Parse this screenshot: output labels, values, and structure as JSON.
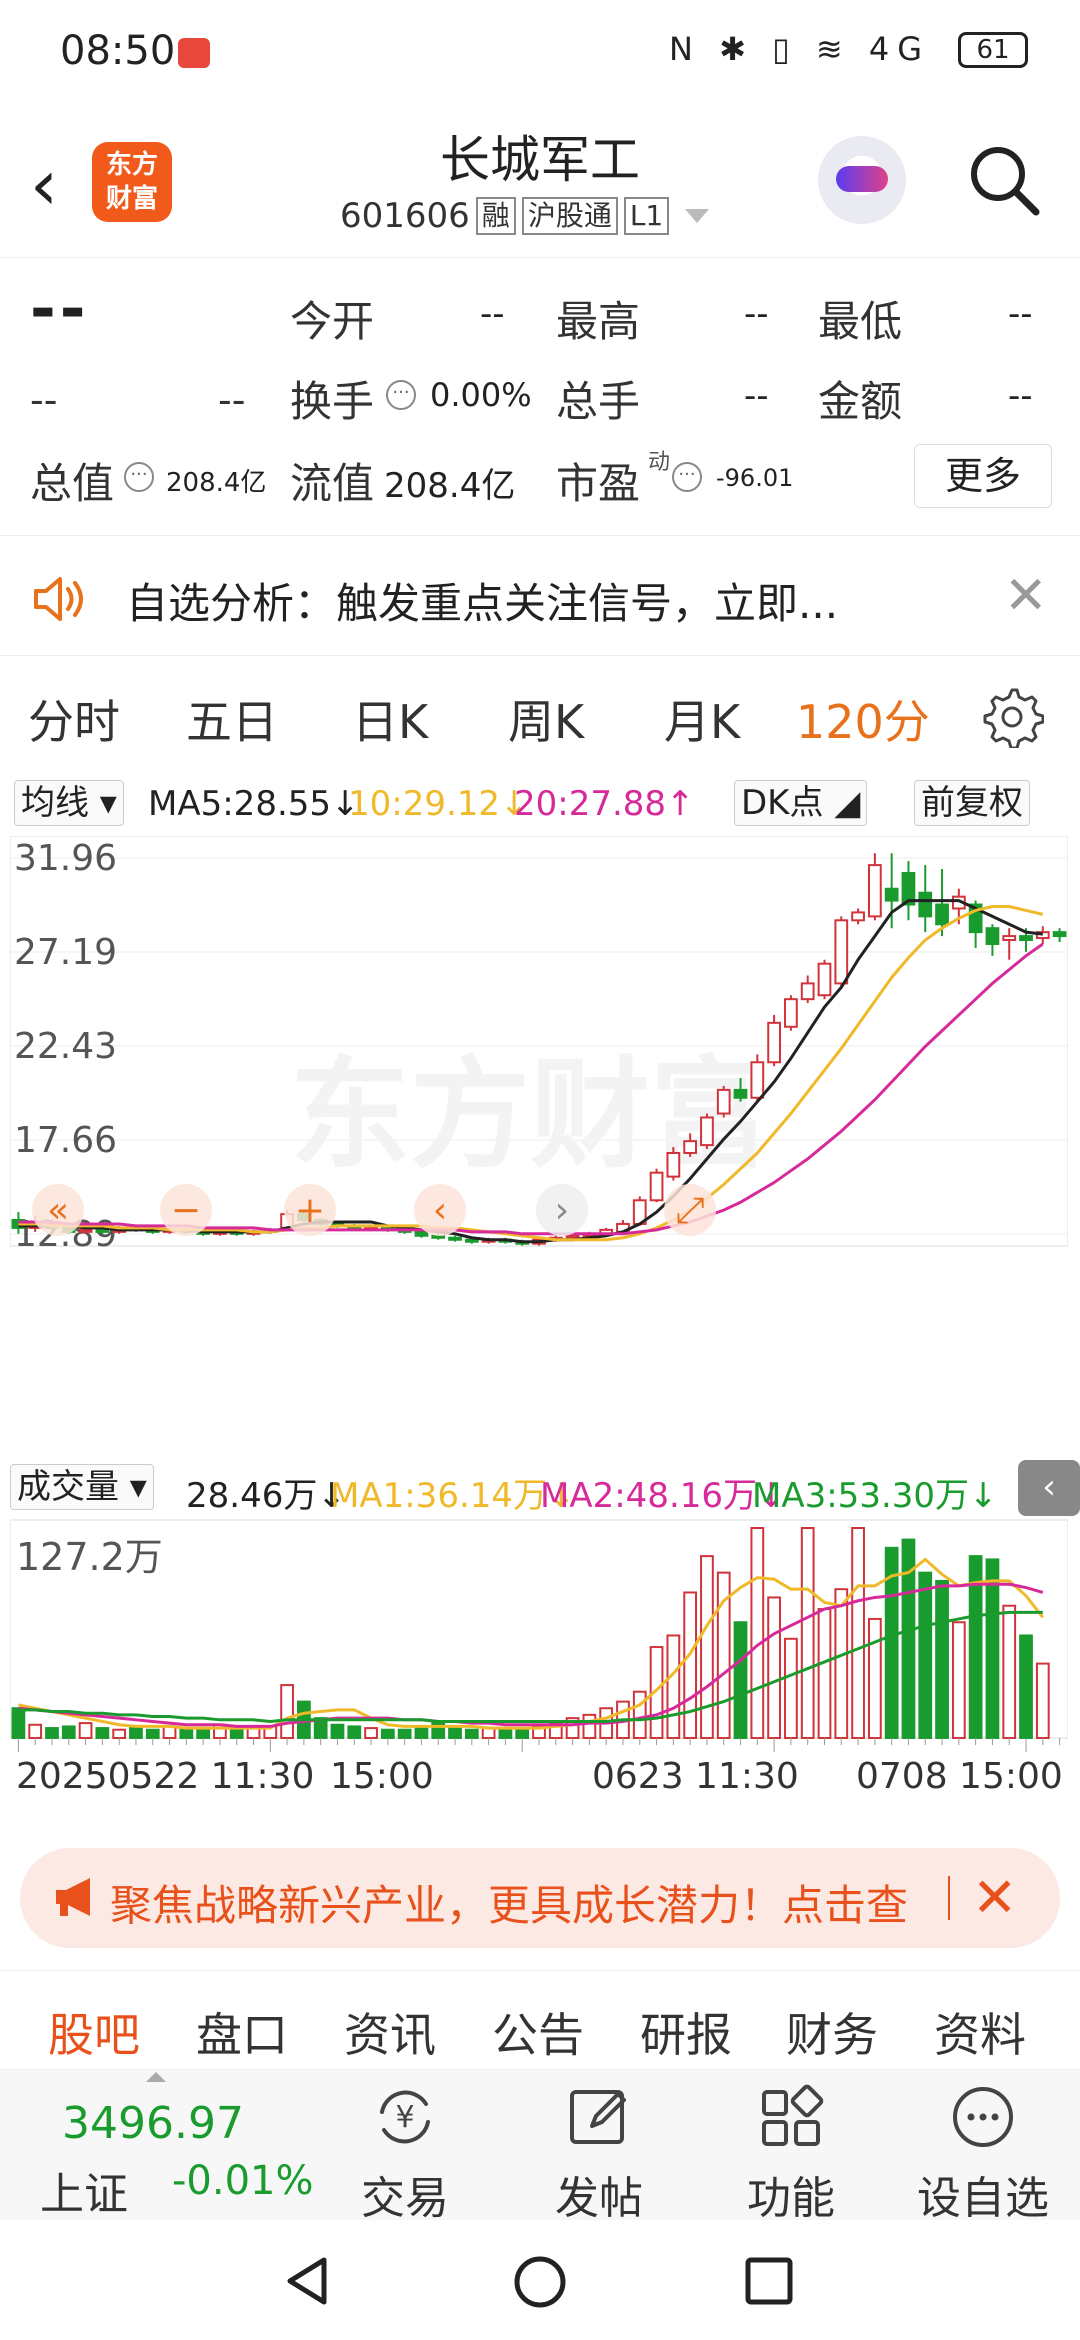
{
  "status_bar": {
    "time": "08:50",
    "icons": "N ✱ ▯ ≋ 4G",
    "battery": "61"
  },
  "header": {
    "title": "长城军工",
    "code": "601606",
    "tags": [
      "融",
      "沪股通",
      "L1"
    ],
    "logo_text": "东方财富"
  },
  "quote": {
    "price": "--",
    "change": "--",
    "change_pct": "--",
    "open_label": "今开",
    "open_value": "--",
    "high_label": "最高",
    "high_value": "--",
    "low_label": "最低",
    "low_value": "--",
    "turnover_label": "换手",
    "turnover_value": "0.00%",
    "volume_label": "总手",
    "volume_value": "--",
    "amount_label": "金额",
    "amount_value": "--",
    "mktcap_label": "总值",
    "mktcap_value": "208.4亿",
    "float_label": "流值",
    "float_value": "208.4亿",
    "pe_label": "市盈",
    "pe_sup": "动",
    "pe_value": "-96.01",
    "more_button": "更多"
  },
  "notice": {
    "text": "自选分析：触发重点关注信号，立即..."
  },
  "period_tabs": [
    "分时",
    "五日",
    "日K",
    "周K",
    "月K",
    "120分"
  ],
  "active_period": "120分",
  "ma_bar": {
    "select": "均线",
    "ma5": "MA5:28.55↓",
    "ma10": "10:29.12↓",
    "ma20": "20:27.88↑",
    "dk_button": "DK点",
    "adjust_button": "前复权"
  },
  "vol_bar": {
    "select": "成交量",
    "vol": "28.46万↓",
    "ma1": "MA1:36.14万↓",
    "ma2": "MA2:48.16万↓",
    "ma3": "MA3:53.30万↓"
  },
  "chart_data": {
    "type": "candlestick",
    "price_ticks": [
      "31.96",
      "27.19",
      "22.43",
      "17.66",
      "12.89"
    ],
    "ylim": [
      12.89,
      31.96
    ],
    "volume_max_label": "127.2万",
    "x_labels": [
      "20250522 11:30",
      "15:00",
      "0623 11:30",
      "0708 15:00"
    ],
    "watermark": "东方财富",
    "candles": [
      {
        "o": 13.6,
        "c": 13.2,
        "h": 14.0,
        "l": 12.9
      },
      {
        "o": 13.2,
        "c": 13.5,
        "h": 13.8,
        "l": 13.0
      },
      {
        "o": 13.4,
        "c": 13.2,
        "h": 13.6,
        "l": 13.0
      },
      {
        "o": 13.2,
        "c": 13.0,
        "h": 13.4,
        "l": 12.9
      },
      {
        "o": 13.0,
        "c": 13.1,
        "h": 13.3,
        "l": 12.9
      },
      {
        "o": 13.1,
        "c": 13.0,
        "h": 13.2,
        "l": 12.9
      },
      {
        "o": 13.0,
        "c": 13.2,
        "h": 13.3,
        "l": 12.9
      },
      {
        "o": 13.2,
        "c": 13.1,
        "h": 13.3,
        "l": 13.0
      },
      {
        "o": 13.1,
        "c": 13.0,
        "h": 13.2,
        "l": 12.9
      },
      {
        "o": 13.0,
        "c": 13.1,
        "h": 13.2,
        "l": 12.9
      },
      {
        "o": 13.1,
        "c": 13.0,
        "h": 13.2,
        "l": 12.9
      },
      {
        "o": 13.0,
        "c": 12.9,
        "h": 13.1,
        "l": 12.8
      },
      {
        "o": 12.9,
        "c": 13.0,
        "h": 13.1,
        "l": 12.8
      },
      {
        "o": 13.0,
        "c": 12.9,
        "h": 13.1,
        "l": 12.8
      },
      {
        "o": 12.9,
        "c": 13.0,
        "h": 13.1,
        "l": 12.8
      },
      {
        "o": 13.0,
        "c": 13.1,
        "h": 13.2,
        "l": 12.9
      },
      {
        "o": 13.2,
        "c": 13.9,
        "h": 14.1,
        "l": 13.1
      },
      {
        "o": 13.9,
        "c": 13.6,
        "h": 14.0,
        "l": 13.5
      },
      {
        "o": 13.6,
        "c": 13.4,
        "h": 13.7,
        "l": 13.3
      },
      {
        "o": 13.4,
        "c": 13.3,
        "h": 13.5,
        "l": 13.2
      },
      {
        "o": 13.3,
        "c": 13.2,
        "h": 13.4,
        "l": 13.1
      },
      {
        "o": 13.2,
        "c": 13.2,
        "h": 13.3,
        "l": 13.1
      },
      {
        "o": 13.2,
        "c": 13.1,
        "h": 13.3,
        "l": 13.0
      },
      {
        "o": 13.1,
        "c": 13.0,
        "h": 13.2,
        "l": 12.9
      },
      {
        "o": 13.0,
        "c": 12.8,
        "h": 13.1,
        "l": 12.7
      },
      {
        "o": 12.8,
        "c": 12.7,
        "h": 12.9,
        "l": 12.6
      },
      {
        "o": 12.7,
        "c": 12.6,
        "h": 12.8,
        "l": 12.5
      },
      {
        "o": 12.6,
        "c": 12.5,
        "h": 12.7,
        "l": 12.4
      },
      {
        "o": 12.5,
        "c": 12.6,
        "h": 12.7,
        "l": 12.4
      },
      {
        "o": 12.6,
        "c": 12.5,
        "h": 12.7,
        "l": 12.4
      },
      {
        "o": 12.5,
        "c": 12.4,
        "h": 12.6,
        "l": 12.3
      },
      {
        "o": 12.4,
        "c": 12.6,
        "h": 12.7,
        "l": 12.3
      },
      {
        "o": 12.6,
        "c": 12.7,
        "h": 12.8,
        "l": 12.5
      },
      {
        "o": 12.7,
        "c": 12.8,
        "h": 12.9,
        "l": 12.6
      },
      {
        "o": 12.8,
        "c": 12.9,
        "h": 13.0,
        "l": 12.7
      },
      {
        "o": 12.9,
        "c": 13.1,
        "h": 13.2,
        "l": 12.8
      },
      {
        "o": 13.0,
        "c": 13.4,
        "h": 13.6,
        "l": 12.9
      },
      {
        "o": 13.4,
        "c": 14.6,
        "h": 14.8,
        "l": 13.3
      },
      {
        "o": 14.6,
        "c": 16.0,
        "h": 16.2,
        "l": 14.5
      },
      {
        "o": 15.8,
        "c": 17.0,
        "h": 17.3,
        "l": 15.6
      },
      {
        "o": 17.0,
        "c": 17.6,
        "h": 18.0,
        "l": 16.8
      },
      {
        "o": 17.4,
        "c": 18.8,
        "h": 19.0,
        "l": 17.2
      },
      {
        "o": 19.0,
        "c": 20.2,
        "h": 20.4,
        "l": 18.8
      },
      {
        "o": 20.2,
        "c": 19.8,
        "h": 20.8,
        "l": 19.6
      },
      {
        "o": 19.8,
        "c": 21.6,
        "h": 22.0,
        "l": 19.6
      },
      {
        "o": 21.6,
        "c": 23.6,
        "h": 24.0,
        "l": 21.4
      },
      {
        "o": 23.4,
        "c": 24.8,
        "h": 25.0,
        "l": 23.2
      },
      {
        "o": 24.8,
        "c": 25.6,
        "h": 26.0,
        "l": 24.6
      },
      {
        "o": 25.0,
        "c": 26.6,
        "h": 26.8,
        "l": 24.8
      },
      {
        "o": 25.6,
        "c": 28.8,
        "h": 29.0,
        "l": 25.4
      },
      {
        "o": 28.8,
        "c": 29.2,
        "h": 29.4,
        "l": 28.6
      },
      {
        "o": 29.0,
        "c": 31.6,
        "h": 32.2,
        "l": 28.8
      },
      {
        "o": 30.4,
        "c": 29.8,
        "h": 32.2,
        "l": 28.4
      },
      {
        "o": 31.2,
        "c": 29.6,
        "h": 31.8,
        "l": 28.8
      },
      {
        "o": 30.2,
        "c": 29.0,
        "h": 31.6,
        "l": 28.2
      },
      {
        "o": 29.6,
        "c": 28.6,
        "h": 31.4,
        "l": 28.0
      },
      {
        "o": 29.4,
        "c": 30.0,
        "h": 30.4,
        "l": 28.6
      },
      {
        "o": 29.6,
        "c": 28.2,
        "h": 29.8,
        "l": 27.4
      },
      {
        "o": 28.4,
        "c": 27.6,
        "h": 28.6,
        "l": 27.0
      },
      {
        "o": 27.8,
        "c": 28.0,
        "h": 28.4,
        "l": 26.8
      },
      {
        "o": 28.0,
        "c": 27.8,
        "h": 28.4,
        "l": 27.2
      },
      {
        "o": 27.9,
        "c": 28.2,
        "h": 28.5,
        "l": 27.6
      },
      {
        "o": 28.2,
        "c": 28.0,
        "h": 28.4,
        "l": 27.7
      }
    ],
    "volumes": [
      18,
      8,
      6,
      7,
      9,
      6,
      5,
      6,
      5,
      7,
      6,
      5,
      8,
      5,
      6,
      7,
      32,
      22,
      12,
      8,
      7,
      6,
      5,
      5,
      7,
      9,
      6,
      5,
      6,
      5,
      6,
      7,
      9,
      12,
      14,
      18,
      22,
      28,
      55,
      62,
      88,
      110,
      100,
      70,
      127,
      85,
      60,
      127,
      78,
      90,
      127,
      72,
      115,
      120,
      100,
      95,
      70,
      110,
      108,
      80,
      62,
      45
    ],
    "ma_ks": [
      {
        "name": "MA5",
        "color": "#222222",
        "values": [
          13.3,
          13.3,
          13.3,
          13.3,
          13.2,
          13.2,
          13.1,
          13.1,
          13.1,
          13.1,
          13.1,
          13.0,
          13.0,
          13.0,
          13.0,
          13.0,
          13.2,
          13.4,
          13.5,
          13.5,
          13.5,
          13.5,
          13.3,
          13.2,
          13.1,
          13.0,
          12.9,
          12.7,
          12.6,
          12.6,
          12.5,
          12.5,
          12.6,
          12.6,
          12.7,
          12.8,
          13.0,
          13.4,
          14.0,
          14.8,
          15.7,
          16.7,
          17.7,
          18.6,
          19.6,
          20.6,
          21.8,
          23.1,
          24.4,
          25.4,
          26.8,
          28.0,
          29.2,
          29.8,
          29.8,
          29.8,
          29.8,
          29.4,
          29.0,
          28.6,
          28.2,
          28.1
        ]
      },
      {
        "name": "MA10",
        "color": "#f0b92a",
        "values": [
          13.4,
          13.4,
          13.3,
          13.3,
          13.3,
          13.3,
          13.2,
          13.2,
          13.2,
          13.1,
          13.1,
          13.1,
          13.1,
          13.1,
          13.0,
          13.0,
          13.1,
          13.2,
          13.2,
          13.3,
          13.3,
          13.3,
          13.3,
          13.3,
          13.3,
          13.2,
          13.2,
          13.1,
          13.0,
          12.9,
          12.8,
          12.7,
          12.6,
          12.6,
          12.6,
          12.6,
          12.7,
          12.9,
          13.2,
          13.6,
          14.1,
          14.7,
          15.4,
          16.2,
          17.0,
          18.0,
          19.0,
          20.1,
          21.2,
          22.3,
          23.5,
          24.7,
          25.9,
          26.9,
          27.8,
          28.4,
          28.9,
          29.3,
          29.5,
          29.5,
          29.3,
          29.1
        ]
      },
      {
        "name": "MA20",
        "color": "#d62a9a",
        "values": [
          13.5,
          13.5,
          13.5,
          13.4,
          13.4,
          13.4,
          13.4,
          13.3,
          13.3,
          13.3,
          13.3,
          13.2,
          13.2,
          13.2,
          13.2,
          13.1,
          13.1,
          13.1,
          13.1,
          13.1,
          13.1,
          13.1,
          13.1,
          13.1,
          13.1,
          13.1,
          13.1,
          13.0,
          13.0,
          13.0,
          12.9,
          12.9,
          12.9,
          12.9,
          12.9,
          12.9,
          12.9,
          13.0,
          13.1,
          13.3,
          13.5,
          13.8,
          14.1,
          14.5,
          15.0,
          15.5,
          16.1,
          16.7,
          17.4,
          18.1,
          18.9,
          19.7,
          20.6,
          21.5,
          22.4,
          23.2,
          24.0,
          24.8,
          25.6,
          26.3,
          27.0,
          27.6
        ]
      }
    ],
    "volume_mas": [
      {
        "name": "MA1",
        "color": "#f0b92a",
        "values": [
          20,
          18,
          16,
          14,
          12,
          10,
          8,
          7,
          7,
          7,
          6,
          6,
          6,
          6,
          6,
          6,
          12,
          15,
          16,
          17,
          17,
          12,
          8,
          7,
          7,
          7,
          7,
          7,
          6,
          6,
          6,
          6,
          7,
          8,
          10,
          12,
          16,
          20,
          29,
          39,
          51,
          68,
          83,
          91,
          97,
          96,
          90,
          90,
          82,
          80,
          92,
          92,
          98,
          100,
          108,
          99,
          92,
          94,
          95,
          95,
          86,
          73
        ]
      },
      {
        "name": "MA2",
        "color": "#d62a9a",
        "values": [
          18,
          17,
          16,
          15,
          14,
          13,
          12,
          11,
          10,
          9,
          8,
          8,
          8,
          7,
          7,
          7,
          9,
          10,
          11,
          12,
          12,
          12,
          12,
          11,
          11,
          10,
          10,
          9,
          9,
          8,
          8,
          8,
          8,
          8,
          9,
          9,
          10,
          12,
          14,
          18,
          24,
          31,
          39,
          47,
          56,
          63,
          68,
          73,
          78,
          80,
          83,
          85,
          86,
          88,
          90,
          92,
          92,
          93,
          93,
          93,
          91,
          88
        ]
      },
      {
        "name": "MA3",
        "color": "#1a9b2e",
        "values": [
          17,
          17,
          16,
          16,
          15,
          15,
          14,
          14,
          13,
          13,
          12,
          12,
          11,
          11,
          11,
          10,
          11,
          11,
          11,
          11,
          11,
          11,
          11,
          11,
          11,
          10,
          10,
          10,
          10,
          10,
          10,
          10,
          10,
          10,
          10,
          10,
          11,
          11,
          12,
          14,
          16,
          19,
          22,
          26,
          30,
          34,
          38,
          42,
          46,
          50,
          54,
          58,
          62,
          65,
          68,
          70,
          72,
          74,
          75,
          76,
          76,
          76
        ]
      }
    ]
  },
  "chart_controls": [
    "«",
    "−",
    "+",
    "‹",
    "›",
    "⤢"
  ],
  "banner": {
    "text": "聚焦战略新兴产业，更具成长潜力！点击查"
  },
  "category_tabs": [
    "股吧",
    "盘口",
    "资讯",
    "公告",
    "研报",
    "财务",
    "资料"
  ],
  "active_category": "股吧",
  "bottom_bar": {
    "index_value": "3496.97",
    "index_name": "上证",
    "index_change": "-0.01%",
    "items": [
      "交易",
      "发帖",
      "功能",
      "设自选"
    ]
  },
  "colors": {
    "up": "#d0343a",
    "down": "#1a9b2e",
    "accent": "#e8711c"
  }
}
